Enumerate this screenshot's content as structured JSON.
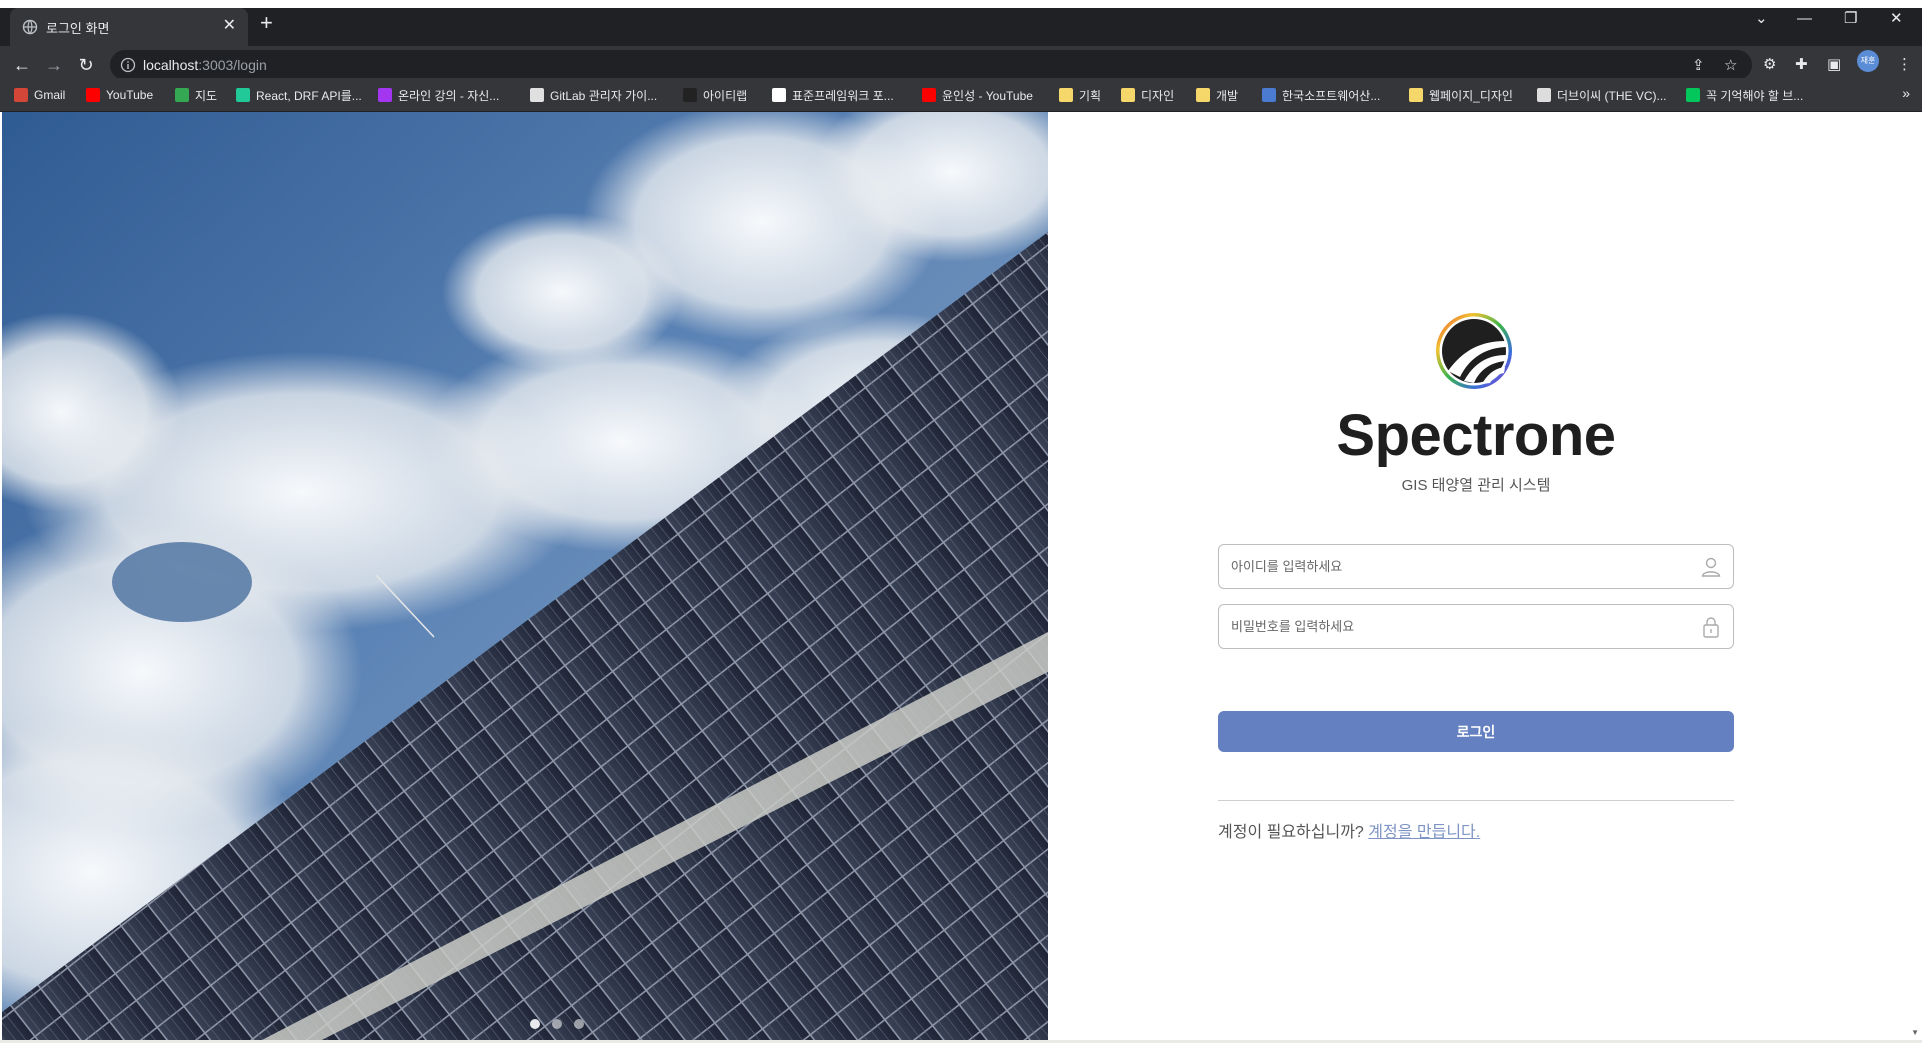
{
  "browser": {
    "tab_title": "로그인 화면",
    "tab_close": "✕",
    "new_tab": "+",
    "url_host": "localhost",
    "url_rest": ":3003/login",
    "avatar_text": "재훈",
    "bookmarks_more": "»"
  },
  "bookmarks": [
    {
      "label": "Gmail",
      "icon": "gmail-icon",
      "color": "#d44638"
    },
    {
      "label": "YouTube",
      "icon": "youtube-icon",
      "color": "#ff0000"
    },
    {
      "label": "지도",
      "icon": "maps-icon",
      "color": "#34a853"
    },
    {
      "label": "React, DRF API를...",
      "icon": "velog-icon",
      "color": "#20c997"
    },
    {
      "label": "온라인 강의 - 자신...",
      "icon": "udemy-icon",
      "color": "#a435f0"
    },
    {
      "label": "GitLab 관리자 가이...",
      "icon": "page-icon",
      "color": "#e0e0e0"
    },
    {
      "label": "아이티랩",
      "icon": "itlab-icon",
      "color": "#222222"
    },
    {
      "label": "표준프레임워크 포...",
      "icon": "egov-icon",
      "color": "#ffffff"
    },
    {
      "label": "윤인성 - YouTube",
      "icon": "youtube-icon",
      "color": "#ff0000"
    },
    {
      "label": "기획",
      "icon": "folder-icon",
      "color": "#f6d76a"
    },
    {
      "label": "디자인",
      "icon": "folder-icon",
      "color": "#f6d76a"
    },
    {
      "label": "개발",
      "icon": "folder-icon",
      "color": "#f6d76a"
    },
    {
      "label": "한국소프트웨어산...",
      "icon": "kosa-icon",
      "color": "#4a7bd0"
    },
    {
      "label": "웹페이지_디자인",
      "icon": "folder-icon",
      "color": "#f6d76a"
    },
    {
      "label": "더브이씨 (THE VC)...",
      "icon": "thevc-icon",
      "color": "#dddddd"
    },
    {
      "label": "꼭 기억해야 할 브...",
      "icon": "naver-icon",
      "color": "#03c75a"
    }
  ],
  "login": {
    "brand": "Spectrone",
    "subtitle": "GIS 태양열 관리 시스템",
    "id_placeholder": "아이디를 입력하세요",
    "pw_placeholder": "비밀번호를 입력하세요",
    "submit_label": "로그인",
    "signup_prompt": "계정이 필요하십니까?",
    "signup_link": "계정을 만듭니다."
  },
  "carousel": {
    "slides": 3,
    "active": 0
  },
  "colors": {
    "primary_button": "#6480c0",
    "link": "#7e94c5"
  }
}
